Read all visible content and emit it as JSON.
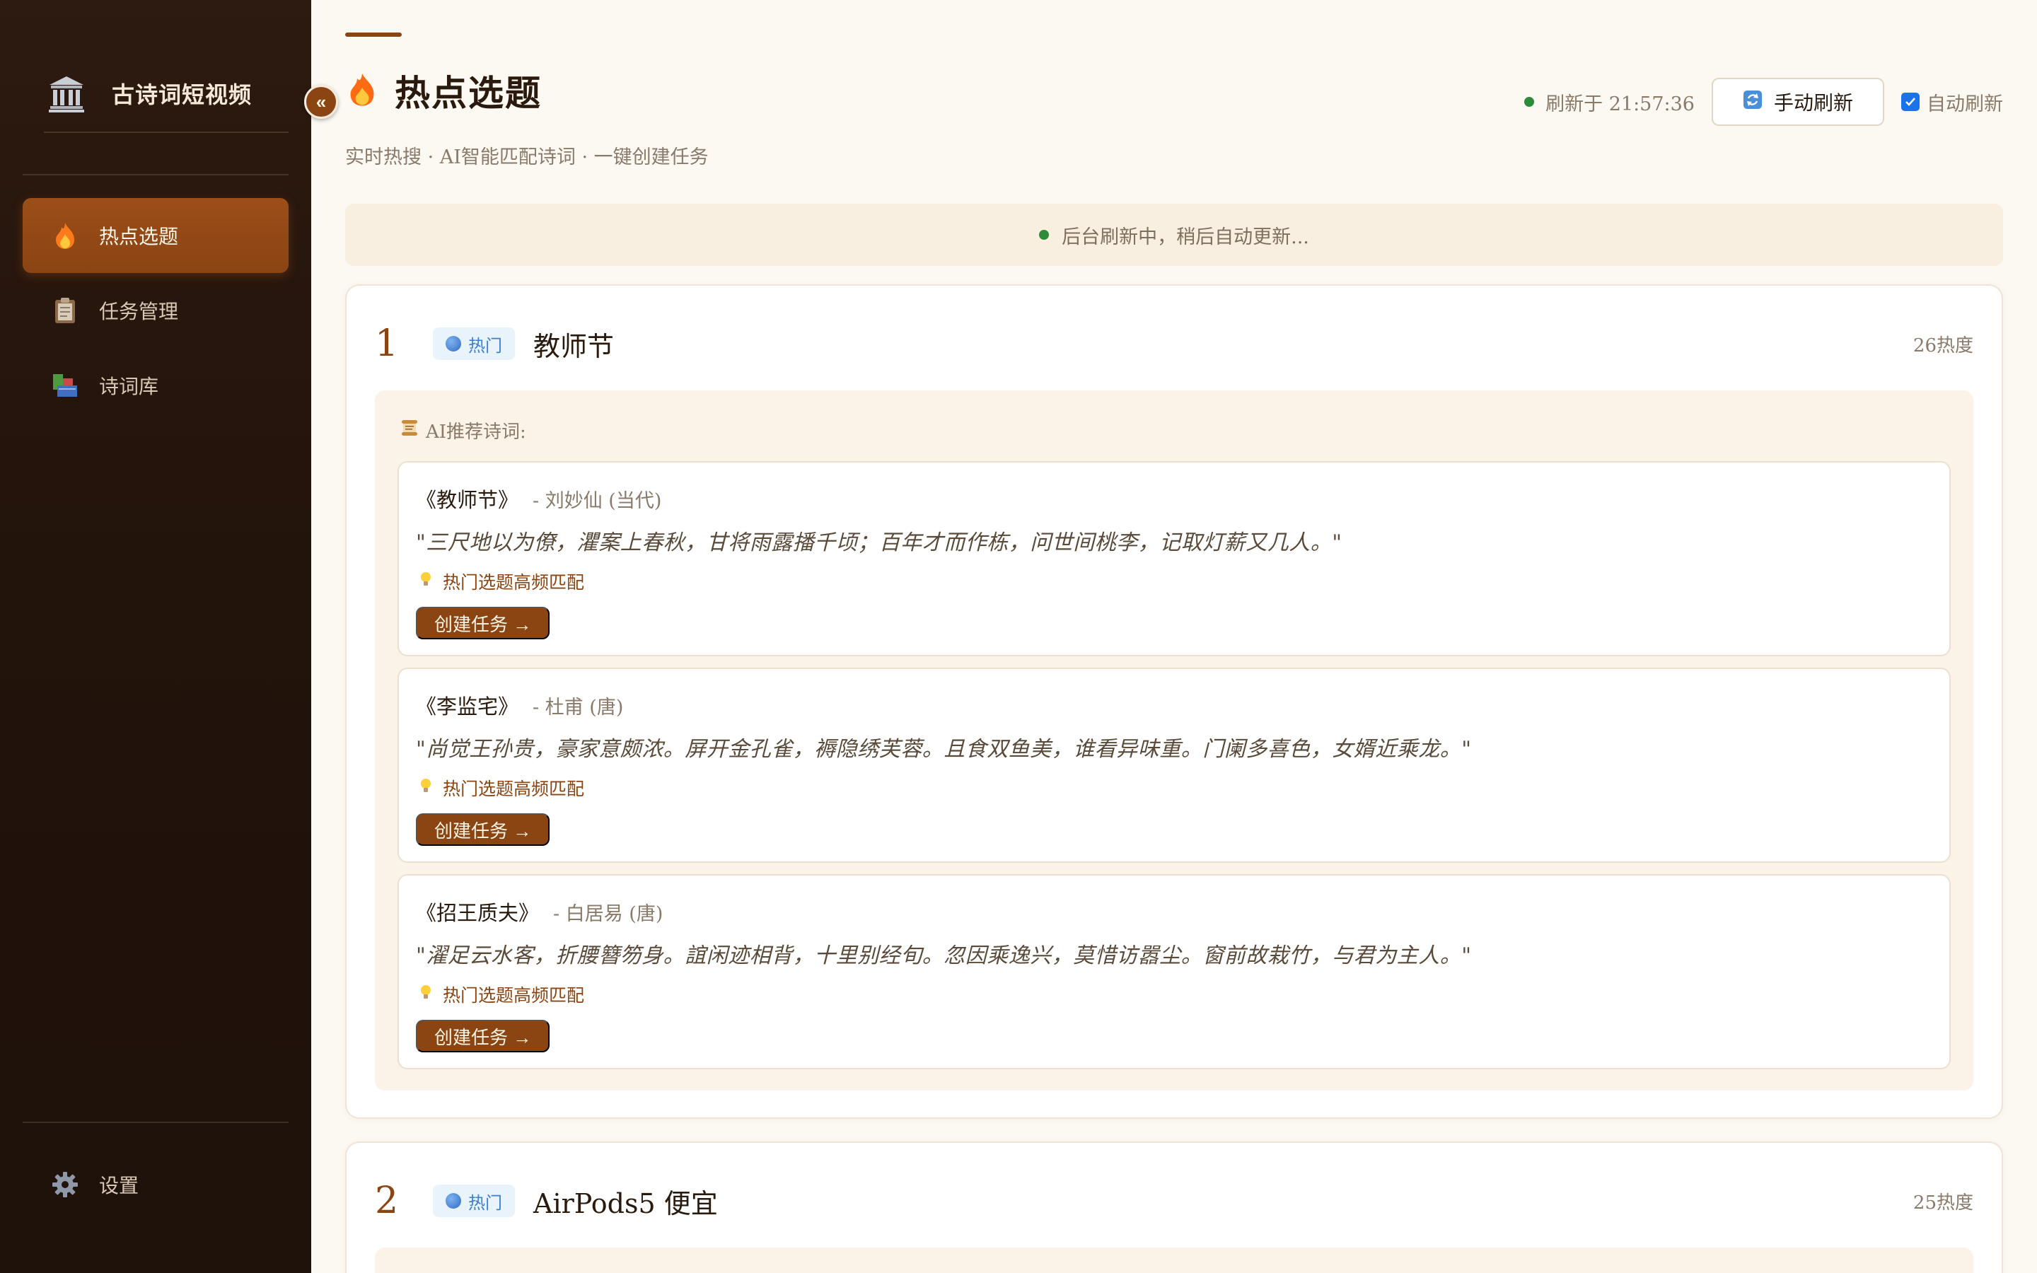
{
  "sidebar": {
    "brand_title": "古诗词短视频",
    "collapse_glyph": "«",
    "nav": [
      {
        "label": "热点选题",
        "icon": "fire-icon",
        "active": true
      },
      {
        "label": "任务管理",
        "icon": "clipboard-icon",
        "active": false
      },
      {
        "label": "诗词库",
        "icon": "books-icon",
        "active": false
      }
    ],
    "settings_label": "设置"
  },
  "header": {
    "title": "热点选题",
    "subtitle": "实时热搜 · AI智能匹配诗词 · 一键创建任务",
    "refresh_status": "刷新于 21:57:36",
    "manual_refresh_label": "手动刷新",
    "auto_refresh_label": "自动刷新",
    "auto_refresh_checked": true
  },
  "banner": {
    "text": "后台刷新中，稍后自动更新..."
  },
  "colors": {
    "accent": "#8b4513",
    "sidebar_bg": "#22130b",
    "live": "#2e8b3a",
    "badge_blue": "#3b7fd0"
  },
  "topics": [
    {
      "rank": "1",
      "badge": "热门",
      "name": "教师节",
      "heat": "26热度",
      "ai_label": "AI推荐诗词:",
      "poems": [
        {
          "title": "《教师节》",
          "author": "- 刘妙仙 (当代)",
          "lines": "\"三尺地以为僚，灈案上春秋，甘将雨露播千顷；百年才而作栋，问世间桃李，记取灯薪又几人。\"",
          "match": "热门选题高频匹配",
          "button": "创建任务 →"
        },
        {
          "title": "《李监宅》",
          "author": "- 杜甫 (唐)",
          "lines": "\"尚觉王孙贵，豪家意颇浓。屏开金孔雀，褥隐绣芙蓉。且食双鱼美，谁看异味重。门阑多喜色，女婿近乘龙。\"",
          "match": "热门选题高频匹配",
          "button": "创建任务 →"
        },
        {
          "title": "《招王质夫》",
          "author": "- 白居易 (唐)",
          "lines": "\"濯足云水客，折腰簪笏身。誼闲迹相背，十里别经旬。忽因乘逸兴，莫惜访嚣尘。窗前故栽竹，与君为主人。\"",
          "match": "热门选题高频匹配",
          "button": "创建任务 →"
        }
      ]
    },
    {
      "rank": "2",
      "badge": "热门",
      "name": "AirPods5 便宜",
      "heat": "25热度"
    }
  ]
}
